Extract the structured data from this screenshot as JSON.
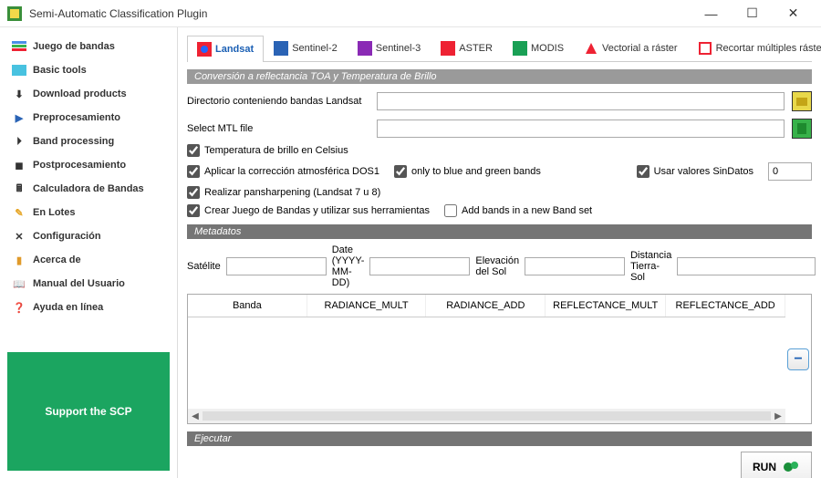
{
  "window": {
    "title": "Semi-Automatic Classification Plugin"
  },
  "sidebar": {
    "items": [
      {
        "label": "Juego de bandas",
        "icon": "#4a8fe7"
      },
      {
        "label": "Basic tools",
        "icon": "#48c2e0"
      },
      {
        "label": "Download products",
        "icon": "#222"
      },
      {
        "label": "Preprocesamiento",
        "icon": "#2a63b5"
      },
      {
        "label": "Band processing",
        "icon": "#222"
      },
      {
        "label": "Postprocesamiento",
        "icon": "#222"
      },
      {
        "label": "Calculadora de Bandas",
        "icon": "#444"
      },
      {
        "label": "En Lotes",
        "icon": "#e6a627"
      },
      {
        "label": "Configuración",
        "icon": "#555"
      },
      {
        "label": "Acerca de",
        "icon": "#e09a2a"
      },
      {
        "label": "Manual del Usuario",
        "icon": "#555"
      },
      {
        "label": "Ayuda en línea",
        "icon": "#1a7f2e"
      }
    ],
    "support": "Support the SCP"
  },
  "tabs": [
    "Landsat",
    "Sentinel-2",
    "Sentinel-3",
    "ASTER",
    "MODIS",
    "Vectorial a ráster",
    "Recortar múltiples rásters"
  ],
  "section1": "Conversión a reflectancia TOA y Temperatura de Brillo",
  "dirRow": {
    "label": "Directorio conteniendo bandas Landsat"
  },
  "mtlRow": {
    "label": "Select MTL file"
  },
  "chk": {
    "celsius": "Temperatura de brillo en Celsius",
    "dos1": "Aplicar la corrección atmosférica DOS1",
    "onlyBG": "only to blue and green bands",
    "nodata": "Usar valores SinDatos",
    "nodataVal": "0",
    "pansharp": "Realizar pansharpening (Landsat 7 u 8)",
    "bandset": "Crear Juego de Bandas y utilizar sus herramientas",
    "addBands": "Add bands in a new Band set"
  },
  "section2": "Metadatos",
  "meta": {
    "satLabel": "Satélite",
    "dateLabel": "Date (YYYY-MM-DD)",
    "sunLabel": "Elevación del Sol",
    "distLabel": "Distancia Tierra-Sol"
  },
  "table": {
    "cols": [
      "Banda",
      "RADIANCE_MULT",
      "RADIANCE_ADD",
      "REFLECTANCE_MULT",
      "REFLECTANCE_ADD"
    ]
  },
  "section3": "Ejecutar",
  "runLabel": "RUN"
}
